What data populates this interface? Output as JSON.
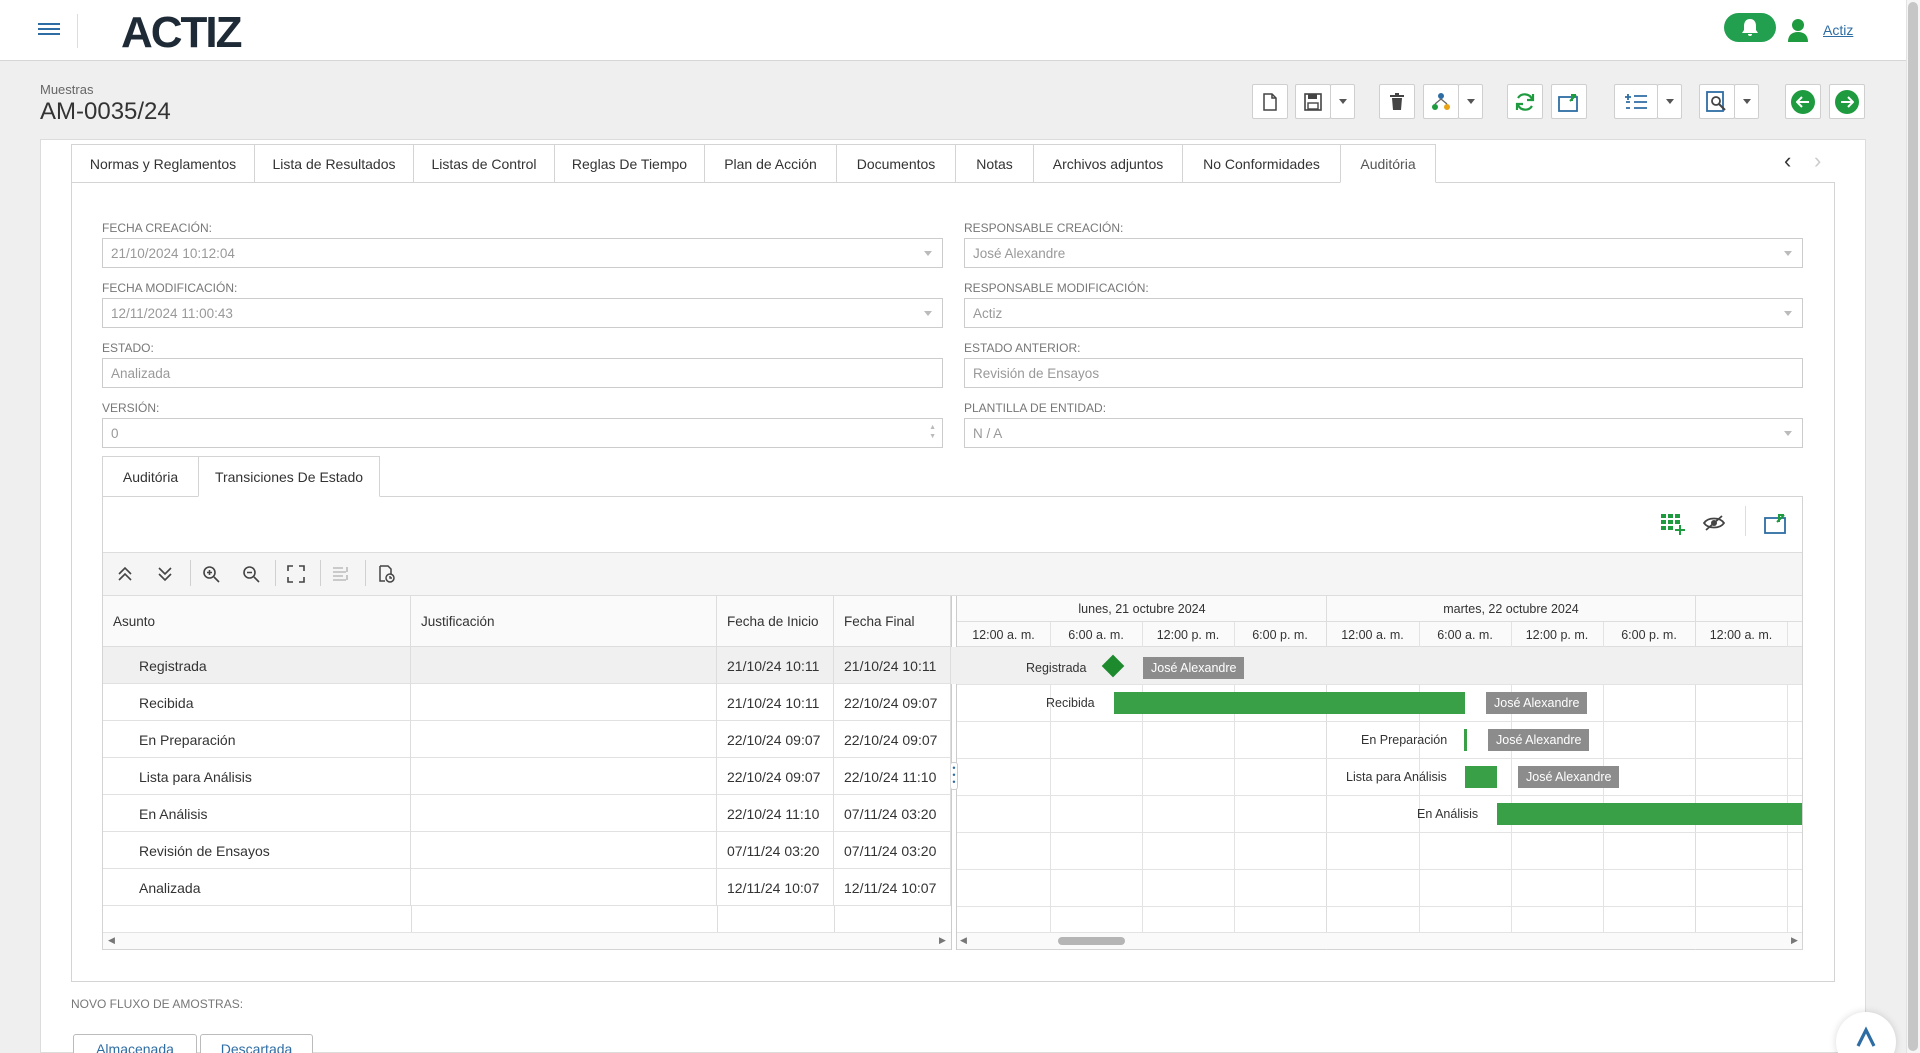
{
  "app": {
    "logo": "ACTIZ",
    "user": "Actiz"
  },
  "header": {
    "section": "Muestras",
    "record_id": "AM-0035/24"
  },
  "toolbar": {
    "icons": [
      "new-document-icon",
      "save-icon",
      "delete-icon",
      "workflow-icon",
      "refresh-icon",
      "export-icon",
      "list-icon",
      "preview-icon",
      "previous-icon",
      "next-icon"
    ]
  },
  "tabs": [
    "Normas y Reglamentos",
    "Lista de Resultados",
    "Listas de Control",
    "Reglas De Tiempo",
    "Plan de Acción",
    "Documentos",
    "Notas",
    "Archivos adjuntos",
    "No Conformidades",
    "Auditória"
  ],
  "active_tab": "Auditória",
  "form": {
    "fecha_creacion": {
      "label": "FECHA CREACIÓN:",
      "value": "21/10/2024 10:12:04"
    },
    "responsable_creacion": {
      "label": "RESPONSABLE CREACIÓN:",
      "value": "José Alexandre"
    },
    "fecha_modificacion": {
      "label": "FECHA MODIFICACIÓN:",
      "value": "12/11/2024 11:00:43"
    },
    "responsable_modificacion": {
      "label": "RESPONSABLE MODIFICACIÓN:",
      "value": "Actiz"
    },
    "estado": {
      "label": "ESTADO:",
      "value": "Analizada"
    },
    "estado_anterior": {
      "label": "ESTADO ANTERIOR:",
      "value": "Revisión de Ensayos"
    },
    "version": {
      "label": "VERSIÓN:",
      "value": "0"
    },
    "plantilla": {
      "label": "PLANTILLA DE ENTIDAD:",
      "value": "N / A"
    }
  },
  "subtabs": [
    "Auditória",
    "Transiciones De Estado"
  ],
  "active_subtab": "Transiciones De Estado",
  "grid": {
    "columns": [
      "Asunto",
      "Justificación",
      "Fecha de Inicio",
      "Fecha Final"
    ],
    "rows": [
      {
        "asunto": "Registrada",
        "justificacion": "",
        "inicio": "21/10/24 10:11",
        "fin": "21/10/24 10:11"
      },
      {
        "asunto": "Recibida",
        "justificacion": "",
        "inicio": "21/10/24 10:11",
        "fin": "22/10/24 09:07"
      },
      {
        "asunto": "En Preparación",
        "justificacion": "",
        "inicio": "22/10/24 09:07",
        "fin": "22/10/24 09:07"
      },
      {
        "asunto": "Lista para Análisis",
        "justificacion": "",
        "inicio": "22/10/24 09:07",
        "fin": "22/10/24 11:10"
      },
      {
        "asunto": "En Análisis",
        "justificacion": "",
        "inicio": "22/10/24 11:10",
        "fin": "07/11/24 03:20"
      },
      {
        "asunto": "Revisión de Ensayos",
        "justificacion": "",
        "inicio": "07/11/24 03:20",
        "fin": "07/11/24 03:20"
      },
      {
        "asunto": "Analizada",
        "justificacion": "",
        "inicio": "12/11/24 10:07",
        "fin": "12/11/24 10:07"
      }
    ]
  },
  "gantt": {
    "days": [
      "lunes, 21 octubre 2024",
      "martes, 22 octubre 2024"
    ],
    "hours": [
      "12:00 a. m.",
      "6:00 a. m.",
      "12:00 p. m.",
      "6:00 p. m.",
      "12:00 a. m.",
      "6:00 a. m.",
      "12:00 p. m.",
      "6:00 p. m.",
      "12:00 a. m."
    ],
    "labels": {
      "registrada": "Registrada",
      "recibida": "Recibida",
      "preparacion": "En Preparación",
      "lista": "Lista para Análisis",
      "analisis": "En Análisis"
    },
    "resource": "José Alexandre",
    "bar_color": "#3aa048"
  },
  "footer": {
    "flow_label": "NOVO FLUXO DE AMOSTRAS:",
    "buttons": [
      "Almacenada",
      "Descartada"
    ]
  },
  "colors": {
    "accent": "#2e6da4",
    "green": "#1e9a3f"
  }
}
